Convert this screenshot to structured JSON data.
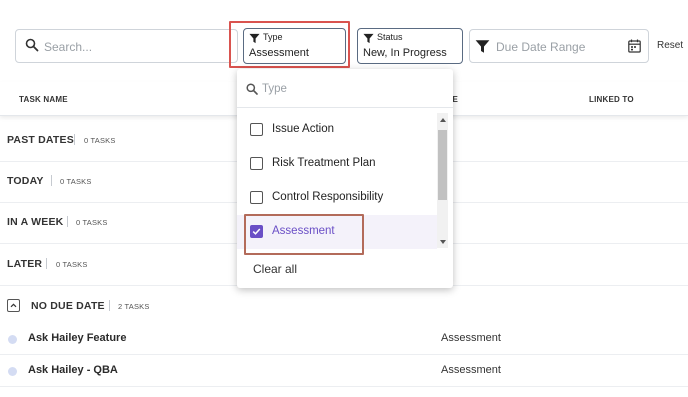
{
  "filters": {
    "search_placeholder": "Search...",
    "type_label": "Type",
    "type_value": "Assessment",
    "status_label": "Status",
    "status_value": "New, In Progress",
    "due_date_placeholder": "Due Date Range",
    "reset_label": "Reset"
  },
  "table": {
    "columns": [
      "TASK NAME",
      "PE",
      "LINKED TO"
    ]
  },
  "groups": [
    {
      "name": "PAST DATES",
      "count": "0 TASKS"
    },
    {
      "name": "TODAY",
      "count": "0 TASKS"
    },
    {
      "name": "IN A WEEK",
      "count": "0 TASKS"
    },
    {
      "name": "LATER",
      "count": "0 TASKS"
    },
    {
      "name": "NO DUE DATE",
      "count": "2 TASKS",
      "expanded": true
    }
  ],
  "tasks": [
    {
      "name": "Ask Hailey Feature",
      "type": "Assessment"
    },
    {
      "name": "Ask Hailey - QBA",
      "type": "Assessment"
    }
  ],
  "dropdown": {
    "search_placeholder": "Type",
    "options": [
      {
        "label": "Issue Action",
        "checked": false
      },
      {
        "label": "Risk Treatment Plan",
        "checked": false
      },
      {
        "label": "Control Responsibility",
        "checked": false
      },
      {
        "label": "Assessment",
        "checked": true
      }
    ],
    "clear_all": "Clear all"
  },
  "colors": {
    "accent": "#6a4fc6",
    "highlight_red": "#d9534f",
    "highlight_brown": "#b36b5a",
    "task_dot": "#d4dcf3"
  }
}
